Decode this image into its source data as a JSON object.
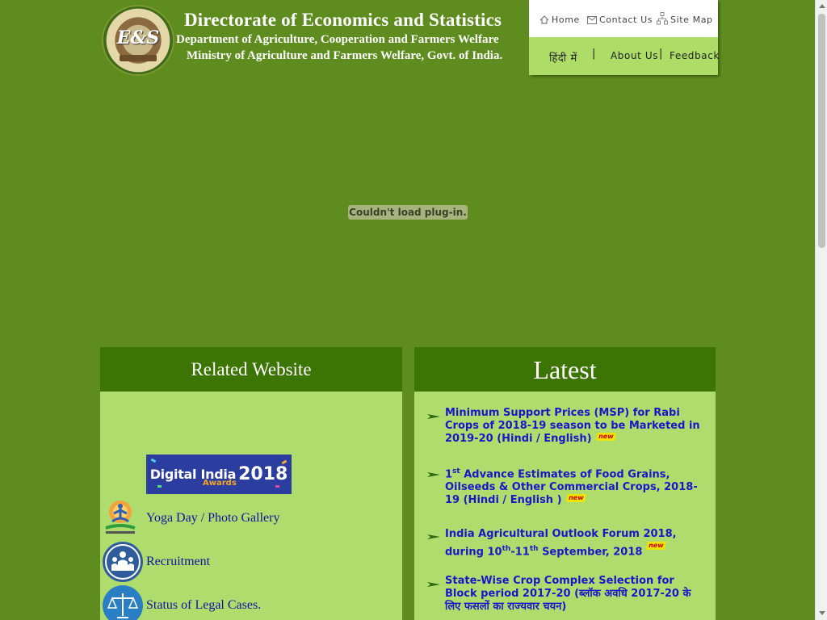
{
  "header": {
    "logo_mark": "E&S",
    "title": "Directorate of Economics and Statistics",
    "department": "Department of Agriculture, Cooperation and Farmers Welfare",
    "ministry": "Ministry of Agriculture and Farmers Welfare, Govt. of India."
  },
  "topnav": {
    "home": "Home",
    "contact": "Contact Us",
    "sitemap": "Site Map",
    "hindi": "हिंदी में",
    "separator": "|",
    "about": "About Us",
    "feedback": "Feedback"
  },
  "plugin_message": "Couldn't load plug-in.",
  "related": {
    "heading": "Related Website",
    "banner": {
      "line1": "Digital India",
      "year": "2018",
      "line2": "Awards"
    },
    "items": [
      {
        "label": "Yoga Day / Photo Gallery",
        "icon": "yoga-icon"
      },
      {
        "label": "Recruitment",
        "icon": "people-icon"
      },
      {
        "label": "Status of Legal Cases.",
        "icon": "scales-icon"
      }
    ]
  },
  "latest": {
    "heading": "Latest",
    "new_badge": "new",
    "items": [
      {
        "text": "Minimum Support Prices (MSP) for Rabi Crops of 2018-19 season to be Marketed in 2019-20 (Hindi / English)"
      },
      {
        "pre": "1",
        "sup": "st",
        "text": " Advance Estimates of Food Grains, Oilseeds & Other Commercial Crops, 2018-19 (Hindi / English )"
      },
      {
        "pre": "India Agricultural Outlook Forum 2018, during 10",
        "sup1": "th",
        "mid": "-11",
        "sup2": "th",
        "post": " September, 2018"
      },
      {
        "text": "State-Wise Crop Complex Selection for Block period 2017-20 (ब्लॉक अवधि 2017-20 के लिए फसलों का राज्यवार चयन)"
      }
    ]
  }
}
